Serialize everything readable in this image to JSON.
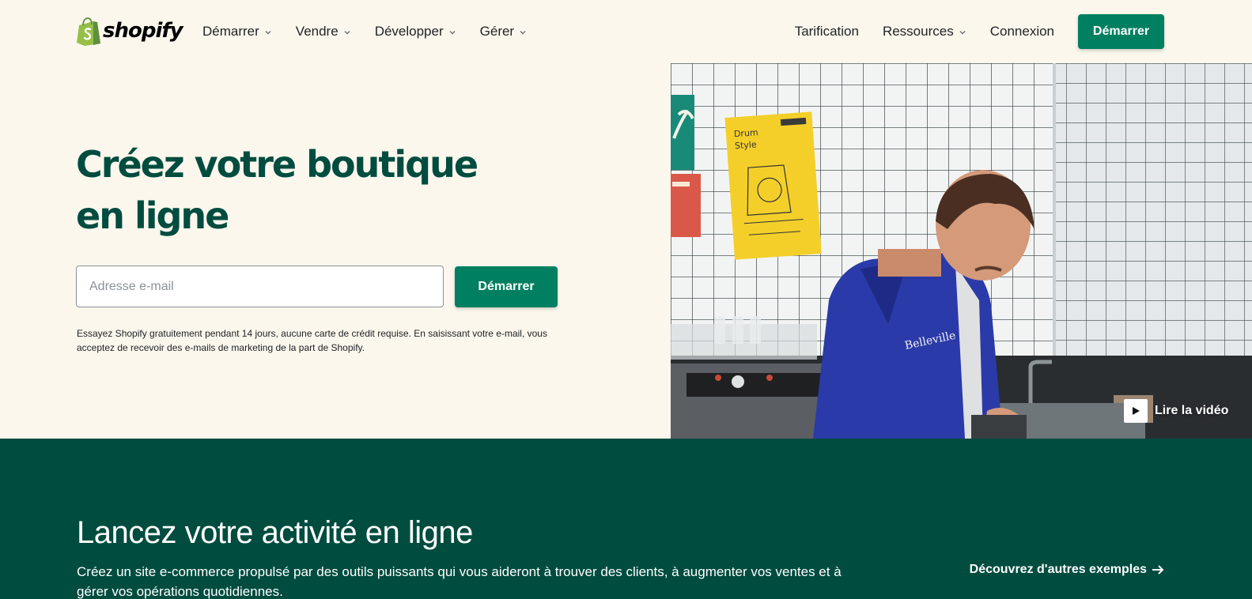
{
  "brand": {
    "name": "shopify",
    "accent": "#008060",
    "dark_green": "#004c3f",
    "background": "#fbf7ed"
  },
  "nav": {
    "left_items": [
      {
        "label": "Démarrer",
        "has_dropdown": true
      },
      {
        "label": "Vendre",
        "has_dropdown": true
      },
      {
        "label": "Développer",
        "has_dropdown": true
      },
      {
        "label": "Gérer",
        "has_dropdown": true
      }
    ],
    "pricing": "Tarification",
    "resources": "Ressources",
    "login": "Connexion",
    "cta": "Démarrer"
  },
  "hero": {
    "title": "Créez votre boutique en ligne",
    "email_placeholder": "Adresse e-mail",
    "cta": "Démarrer",
    "note": "Essayez Shopify gratuitement pendant 14 jours, aucune carte de crédit requise. En saisissant votre e-mail, vous acceptez de recevoir des e-mails de marketing de la part de Shopify."
  },
  "video": {
    "label": "Lire la vidéo",
    "play_icon": "play-icon"
  },
  "section": {
    "title": "Lancez votre activité en ligne",
    "text": "Créez un site e-commerce propulsé par des outils puissants qui vous aideront à trouver des clients, à augmenter vos ventes et à gérer vos opérations quotidiennes.",
    "link": "Découvrez d'autres exemples",
    "link_icon": "arrow-right-icon"
  }
}
